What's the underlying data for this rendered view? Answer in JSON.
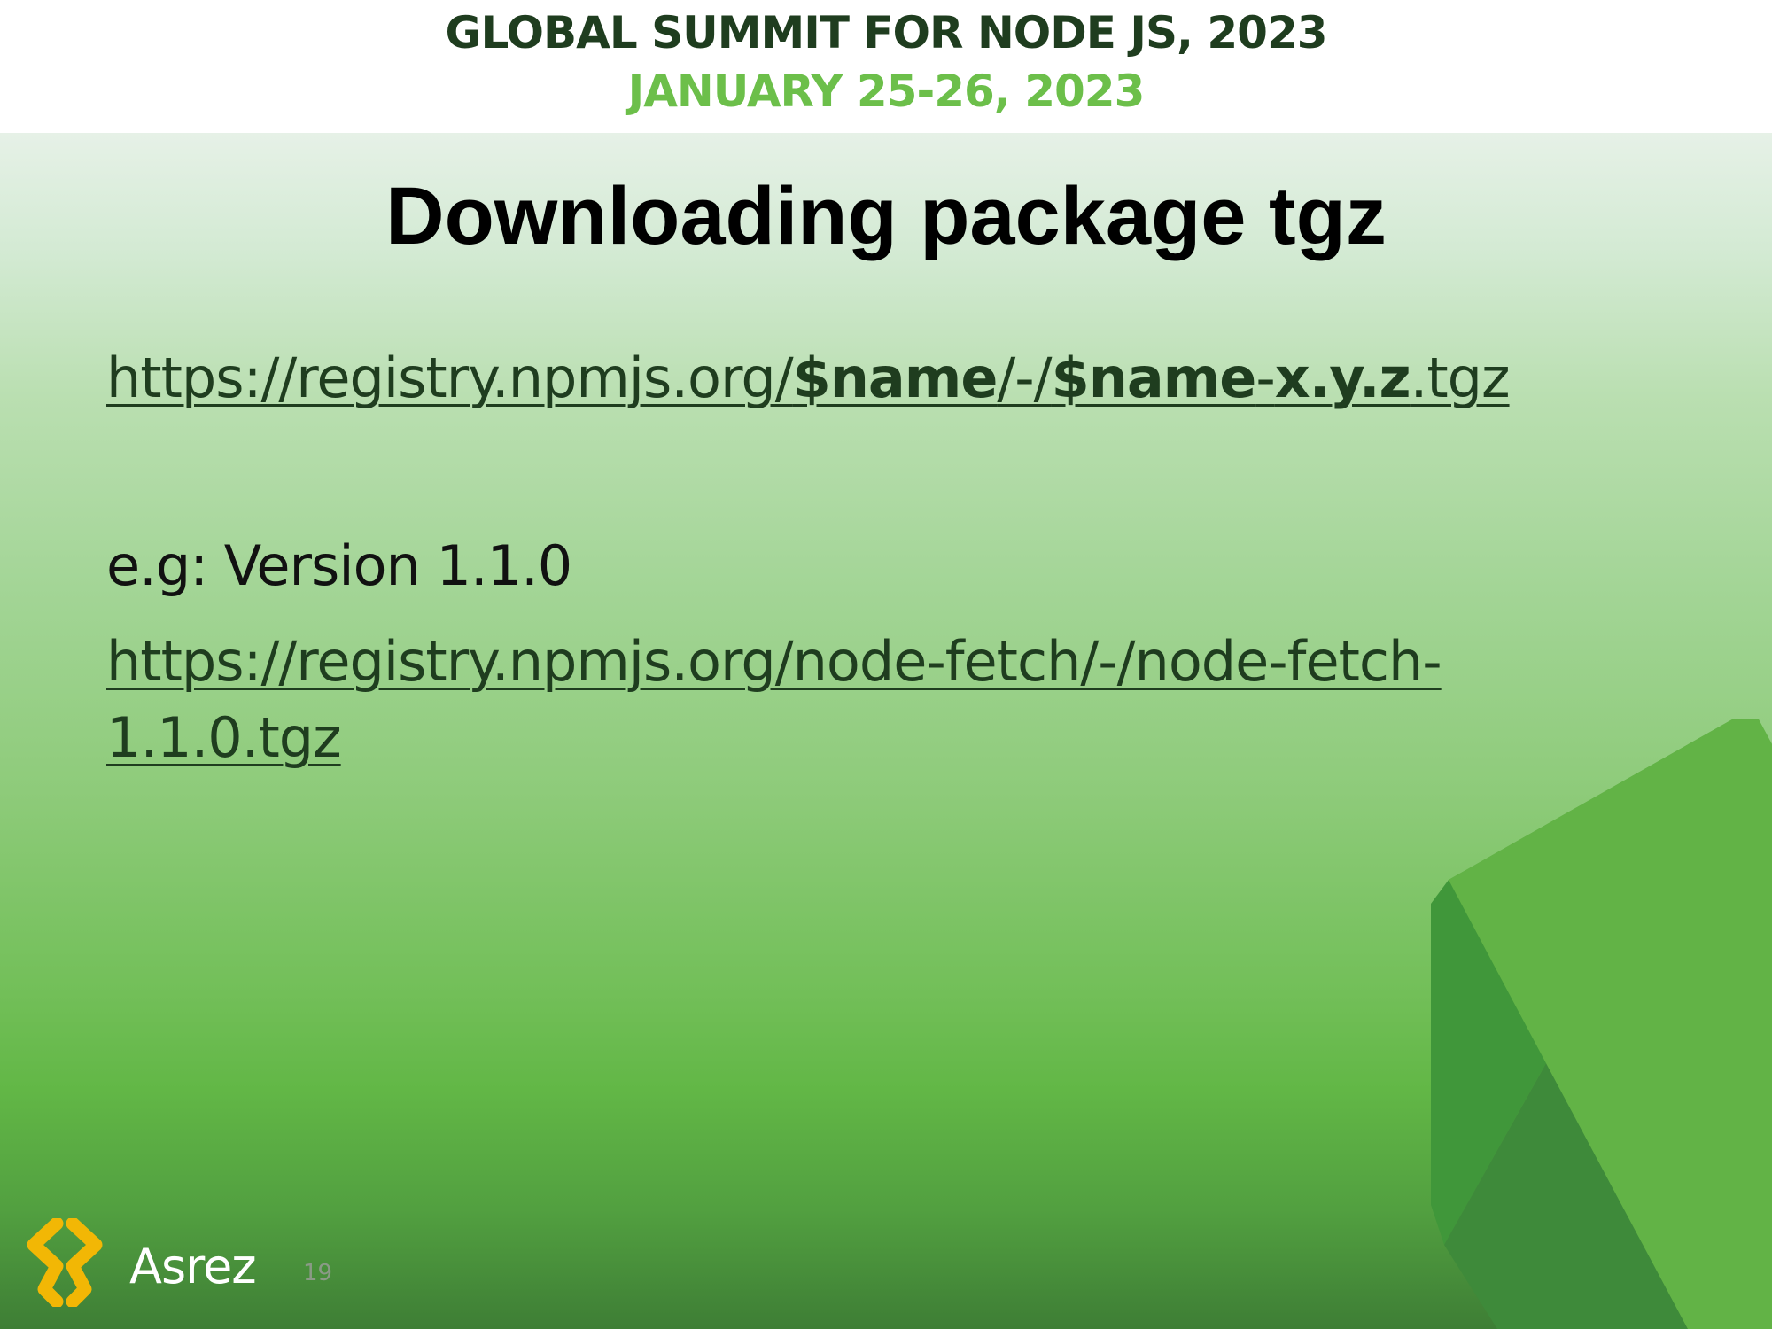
{
  "header": {
    "title": "GLOBAL SUMMIT FOR NODE JS, 2023",
    "date": "JANUARY 25-26, 2023"
  },
  "slide": {
    "title": "Downloading package tgz",
    "template_url": {
      "prefix": "https://registry.npmjs.org/",
      "name1": "$name",
      "sep": "/-/",
      "name2": "$name",
      "dash": "-",
      "version": "x.y.z",
      "suffix": ".tgz"
    },
    "example_label": "e.g: Version 1.1.0",
    "example_url_line1": "https://registry.npmjs.org/node-fetch/-/node-fetch-",
    "example_url_line2": "1.1.0.tgz"
  },
  "footer": {
    "logo_text": "Asrez",
    "page_number": "19"
  },
  "colors": {
    "header_title": "#1f3d1f",
    "header_date": "#6cbf4a",
    "logo_mark": "#f2b705"
  },
  "icons": {
    "logo": "asrez-logo-icon",
    "decoration": "nodejs-hexagon-shape"
  }
}
